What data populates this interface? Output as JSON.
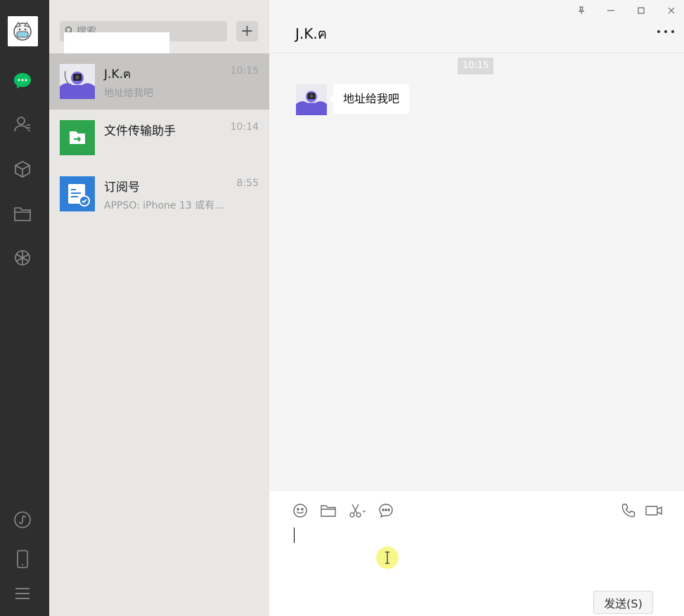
{
  "search": {
    "placeholder": "搜索"
  },
  "add_button": {
    "label": "+"
  },
  "sessions": [
    {
      "name": "J.K.ฅ",
      "time": "10:15",
      "preview": "地址给我吧"
    },
    {
      "name": "文件传输助手",
      "time": "10:14",
      "preview": ""
    },
    {
      "name": "订阅号",
      "time": "8:55",
      "preview": "APPSO: iPhone 13 或有…"
    }
  ],
  "chat": {
    "title": "J.K.ฅ",
    "timestamp": "10:15",
    "messages": [
      {
        "from": "J.K.ฅ",
        "text": "地址给我吧"
      }
    ]
  },
  "composer": {
    "send_label": "发送(S)"
  },
  "colors": {
    "nav_bg": "#2e2e2e",
    "accent_green": "#07c160",
    "file_green": "#2ea44f",
    "subscribe_blue": "#2f7fd8"
  }
}
